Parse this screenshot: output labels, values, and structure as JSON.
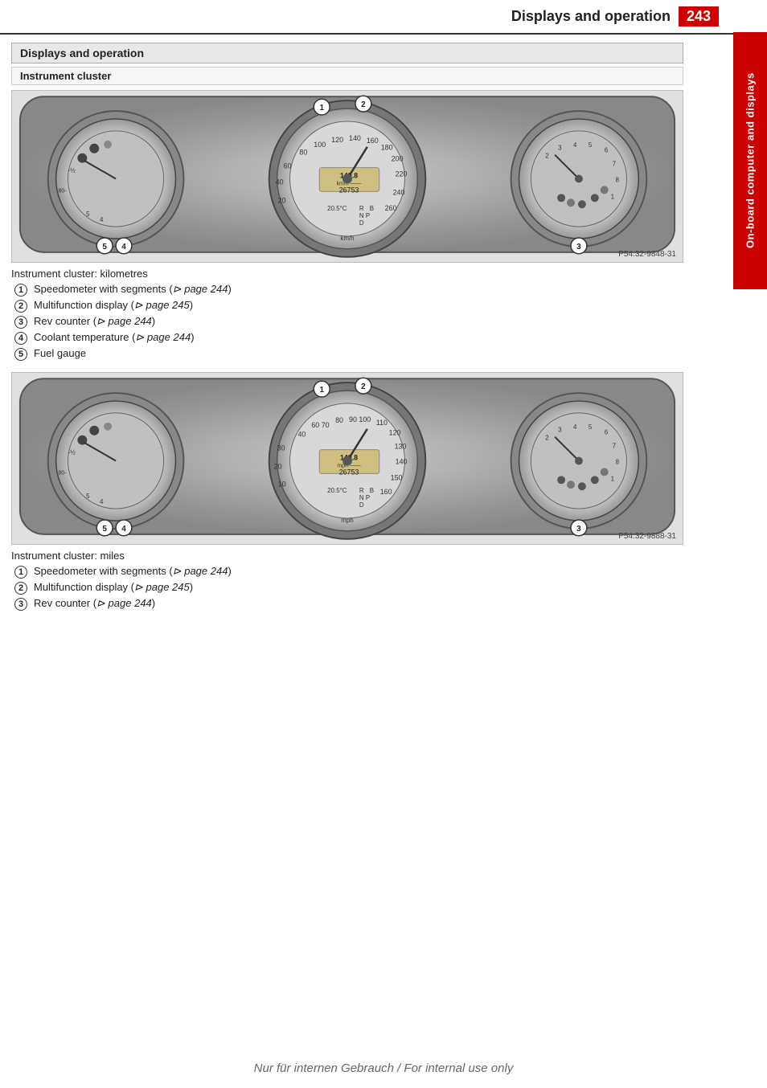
{
  "header": {
    "title": "Displays and operation",
    "page_number": "243"
  },
  "side_tab": {
    "label": "On-board computer and displays"
  },
  "section": {
    "title": "Displays and operation",
    "subsection": "Instrument cluster"
  },
  "image1": {
    "caption": "Instrument cluster: kilometres",
    "ref": "P54.32-9848-31"
  },
  "image2": {
    "caption": "Instrument cluster: miles",
    "ref": "P54.32-9888-31"
  },
  "list1": [
    {
      "num": "1",
      "text": "Speedometer with segments (",
      "link": "⊳ page 244",
      "close": ")"
    },
    {
      "num": "2",
      "text": "Multifunction display (",
      "link": "⊳ page 245",
      "close": ")"
    },
    {
      "num": "3",
      "text": "Rev counter (",
      "link": "⊳ page 244",
      "close": ")"
    },
    {
      "num": "4",
      "text": "Coolant temperature (",
      "link": "⊳ page 244",
      "close": ")"
    },
    {
      "num": "5",
      "text": "Fuel gauge",
      "link": "",
      "close": ""
    }
  ],
  "list2": [
    {
      "num": "1",
      "text": "Speedometer with segments (",
      "link": "⊳ page 244",
      "close": ")"
    },
    {
      "num": "2",
      "text": "Multifunction display (",
      "link": "⊳ page 245",
      "close": ")"
    },
    {
      "num": "3",
      "text": "Rev counter (",
      "link": "⊳ page 244",
      "close": ")"
    }
  ],
  "footer": {
    "watermark": "Nur für internen Gebrauch / For internal use only"
  }
}
